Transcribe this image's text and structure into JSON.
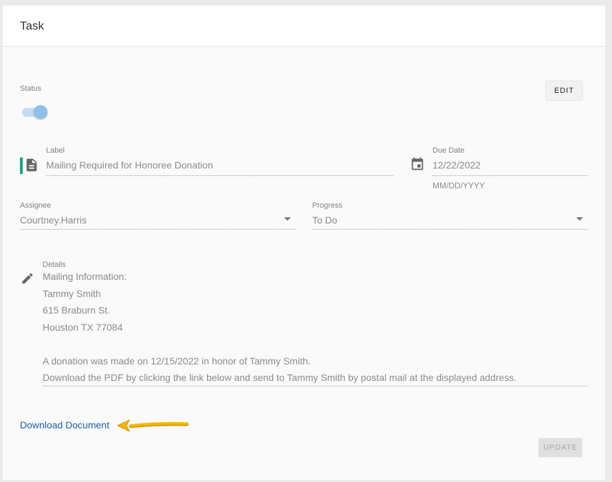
{
  "card": {
    "title": "Task"
  },
  "status": {
    "label": "Status",
    "enabled": true
  },
  "edit_button": {
    "label": "EDIT"
  },
  "label_field": {
    "label": "Label",
    "value": "Mailing Required for Honoree Donation",
    "icon": "document-icon",
    "accent_color": "#1aa37a"
  },
  "due_date": {
    "label": "Due Date",
    "value": "12/22/2022",
    "hint": "MM/DD/YYYY",
    "icon": "calendar-icon"
  },
  "assignee": {
    "label": "Assignee",
    "value": "Courtney.Harris"
  },
  "progress": {
    "label": "Progress",
    "value": "To Do"
  },
  "details": {
    "label": "Details",
    "icon": "pencil-icon",
    "lines": [
      "Mailing Information:",
      "Tammy Smith",
      "615 Braburn St.",
      "Houston TX 77084",
      "",
      "A donation was made on 12/15/2022 in honor of Tammy Smith.",
      "Download the PDF by clicking the link below and send to Tammy Smith by postal mail at the displayed address."
    ]
  },
  "download_link": {
    "label": "Download Document",
    "annotation_color": "#f0b400"
  },
  "update_button": {
    "label": "UPDATE"
  }
}
